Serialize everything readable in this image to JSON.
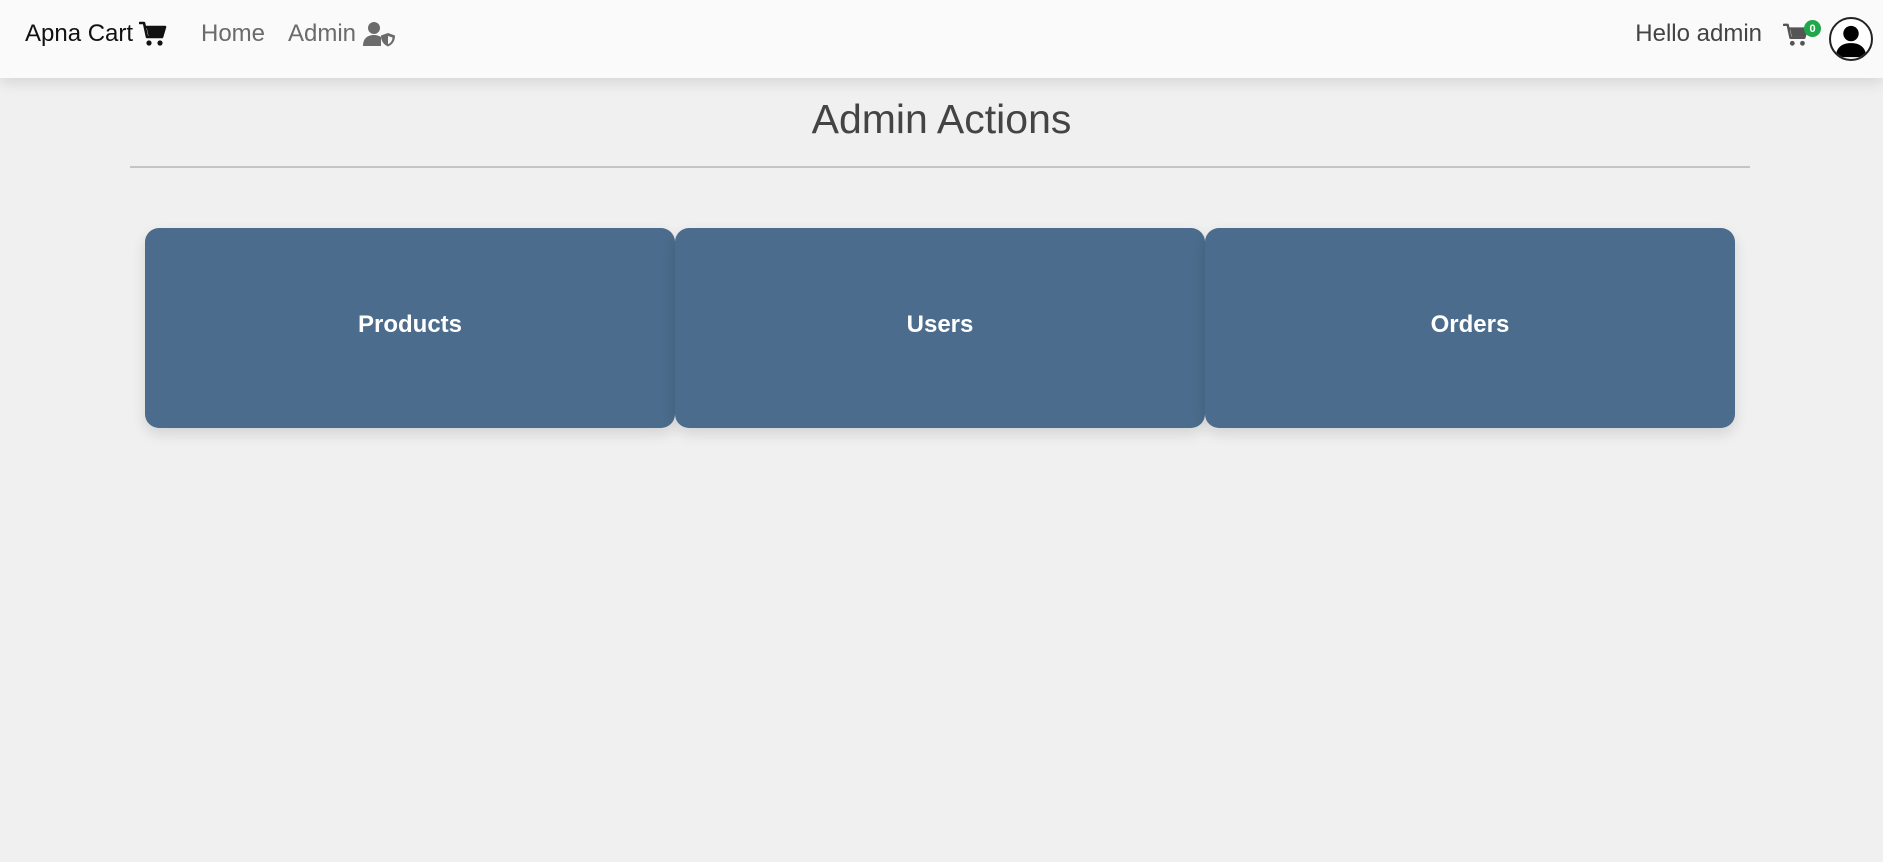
{
  "navbar": {
    "brand": "Apna Cart",
    "links": [
      {
        "label": "Home"
      },
      {
        "label": "Admin"
      }
    ],
    "greeting": "Hello admin",
    "cart_count": "0"
  },
  "main": {
    "title": "Admin Actions",
    "cards": [
      {
        "label": "Products"
      },
      {
        "label": "Users"
      },
      {
        "label": "Orders"
      }
    ]
  },
  "colors": {
    "card_bg": "#4b6c8c",
    "badge": "#1fa84a",
    "page_bg": "#f0f0f0",
    "navbar_bg": "#fafafa"
  },
  "icons": [
    "shopping-cart-icon",
    "user-shield-icon",
    "shopping-cart-icon",
    "user-avatar-icon"
  ]
}
